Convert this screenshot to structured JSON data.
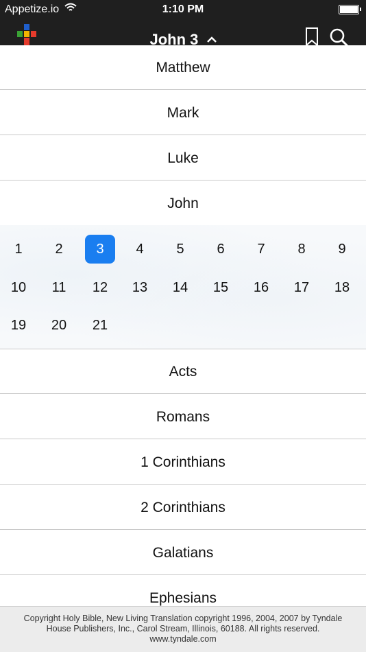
{
  "status_bar": {
    "carrier": "Appetize.io",
    "time": "1:10 PM"
  },
  "nav": {
    "title": "John 3",
    "icons": [
      "app-logo-icon",
      "chevron-up-icon",
      "bookmark-icon",
      "search-icon"
    ]
  },
  "books_before": [
    "Matthew",
    "Mark",
    "Luke",
    "John"
  ],
  "chapters": {
    "items": [
      "1",
      "2",
      "3",
      "4",
      "5",
      "6",
      "7",
      "8",
      "9",
      "10",
      "11",
      "12",
      "13",
      "14",
      "15",
      "16",
      "17",
      "18",
      "19",
      "20",
      "21"
    ],
    "selected": "3",
    "accent": "#1a7ef0"
  },
  "books_after": [
    "Acts",
    "Romans",
    "1 Corinthians",
    "2 Corinthians",
    "Galatians",
    "Ephesians"
  ],
  "footer": {
    "line1": "Copyright Holy Bible, New Living Translation copyright 1996, 2004, 2007 by Tyndale",
    "line2": "House Publishers, Inc., Carol Stream, Illinois, 60188. All rights reserved.",
    "line3": "www.tyndale.com"
  }
}
